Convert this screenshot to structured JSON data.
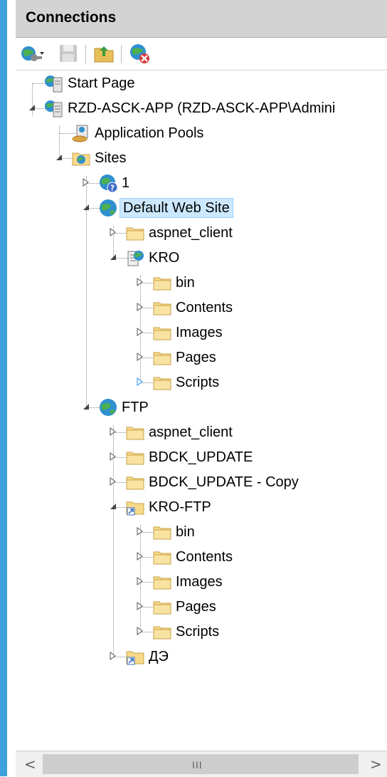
{
  "header": {
    "title": "Connections"
  },
  "toolbar": {
    "buttons": [
      {
        "name": "connect-icon"
      },
      {
        "name": "save-icon"
      },
      {
        "name": "up-folder-icon"
      },
      {
        "name": "disconnect-icon"
      }
    ]
  },
  "tree": [
    {
      "label": "Start Page",
      "icon": "start-page-icon"
    },
    {
      "label": "RZD-ASCK-APP (RZD-ASCK-APP\\Admini",
      "icon": "server-icon"
    },
    {
      "label": "Application Pools",
      "icon": "app-pools-icon"
    },
    {
      "label": "Sites",
      "icon": "sites-folder-icon"
    },
    {
      "label": "1",
      "icon": "site-unknown-icon"
    },
    {
      "label": "Default Web Site",
      "icon": "globe-icon",
      "selected": true
    },
    {
      "label": "aspnet_client",
      "icon": "folder-icon"
    },
    {
      "label": "KRO",
      "icon": "web-app-icon"
    },
    {
      "label": "bin",
      "icon": "folder-icon"
    },
    {
      "label": "Contents",
      "icon": "folder-icon"
    },
    {
      "label": "Images",
      "icon": "folder-icon"
    },
    {
      "label": "Pages",
      "icon": "folder-icon"
    },
    {
      "label": "Scripts",
      "icon": "folder-icon"
    },
    {
      "label": "FTP",
      "icon": "globe-icon"
    },
    {
      "label": "aspnet_client",
      "icon": "folder-icon"
    },
    {
      "label": "BDCK_UPDATE",
      "icon": "folder-icon"
    },
    {
      "label": "BDCK_UPDATE - Copy",
      "icon": "folder-icon"
    },
    {
      "label": "KRO-FTP",
      "icon": "virtual-dir-icon"
    },
    {
      "label": "bin",
      "icon": "folder-icon"
    },
    {
      "label": "Contents",
      "icon": "folder-icon"
    },
    {
      "label": "Images",
      "icon": "folder-icon"
    },
    {
      "label": "Pages",
      "icon": "folder-icon"
    },
    {
      "label": "Scripts",
      "icon": "folder-icon"
    },
    {
      "label": "ДЭ",
      "icon": "virtual-dir-icon"
    }
  ],
  "scrollbar": {
    "left_arrow": "<",
    "right_arrow": ">",
    "grip": "III"
  },
  "colors": {
    "accent": "#3ea0dc",
    "header_bg": "#d3d3d3",
    "selection_bg": "#cce8ff",
    "selection_border": "#99d1ff"
  }
}
